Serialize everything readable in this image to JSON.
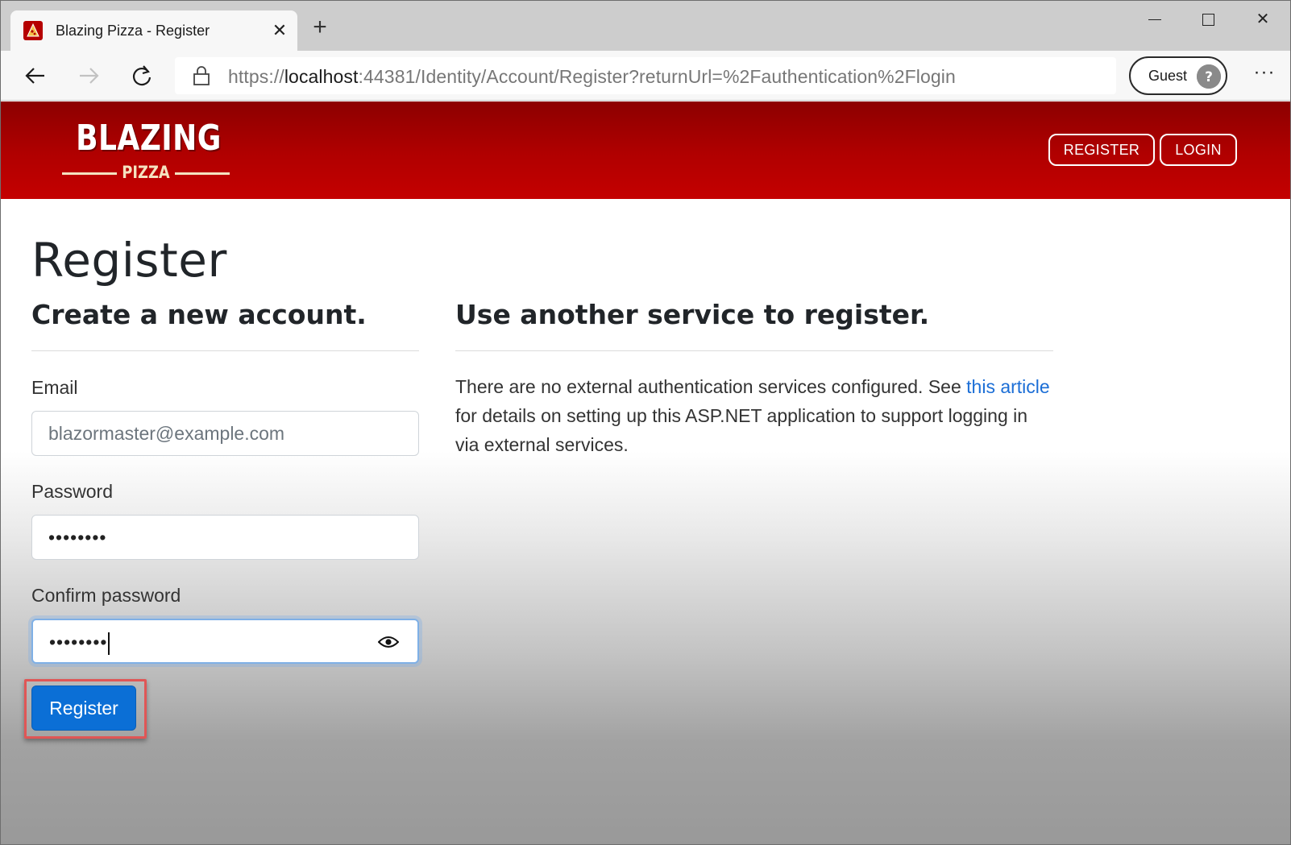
{
  "browser": {
    "tab_title": "Blazing Pizza - Register",
    "tab_close": "✕",
    "new_tab": "+",
    "url_prefix": "https://",
    "url_host": "localhost",
    "url_rest": ":44381/Identity/Account/Register?returnUrl=%2Fauthentication%2Flogin",
    "profile_label": "Guest",
    "more": "···",
    "window_close": "✕"
  },
  "header": {
    "logo_main": "BLAZING",
    "logo_sub": "PIZZA",
    "register_label": "REGISTER",
    "login_label": "LOGIN",
    "brand_color": "#b10000"
  },
  "page": {
    "title": "Register",
    "create_heading": "Create a new account.",
    "external_heading": "Use another service to register.",
    "email_label": "Email",
    "email_value": "blazormaster@example.com",
    "password_label": "Password",
    "password_value": "••••••••",
    "confirm_label": "Confirm password",
    "confirm_value": "••••••••",
    "register_button": "Register",
    "external_text_1": "There are no external authentication services configured. See ",
    "external_link_1": "this",
    "external_link_2": "article",
    "external_text_2": " for details on setting up this ASP.NET application to support logging in via external services."
  },
  "icons": {
    "favicon": "pizza-favicon-icon",
    "back": "back-arrow-icon",
    "forward": "forward-arrow-icon",
    "refresh": "refresh-icon",
    "lock": "lock-icon",
    "avatar": "guest-avatar-icon",
    "eye": "eye-icon"
  },
  "colors": {
    "primary_button": "#0b6fd6",
    "link": "#1b6ed6",
    "highlight": "#e05656"
  }
}
